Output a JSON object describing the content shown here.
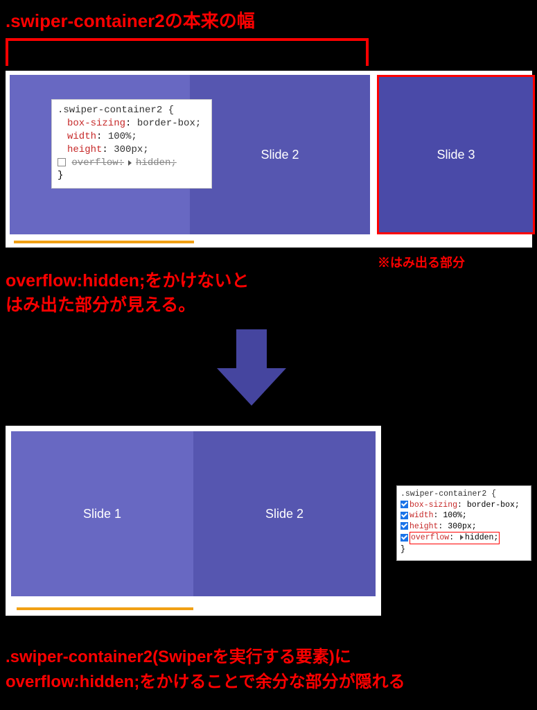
{
  "title": ".swiper-container2の本来の幅",
  "slides_top": {
    "s1": "",
    "s2": "Slide 2",
    "s3": "Slide 3"
  },
  "slides_bottom": {
    "s1": "Slide 1",
    "s2": "Slide 2"
  },
  "devtools_top": {
    "selector": ".swiper-container2 {",
    "p1": "box-sizing",
    "v1": "border-box;",
    "p2": "width",
    "v2": "100%;",
    "p3": "height",
    "v3": "300px;",
    "p4": "overflow:",
    "v4": "hidden;",
    "close": "}"
  },
  "devtools_bottom": {
    "selector": ".swiper-container2 {",
    "p1": "box-sizing",
    "v1": "border-box;",
    "p2": "width",
    "v2": "100%;",
    "p3": "height",
    "v3": "300px;",
    "p4": "overflow",
    "v4": "hidden;",
    "close": "}"
  },
  "notes": {
    "overflow_part": "※はみ出る部分",
    "main_l1": "overflow:hidden;をかけないと",
    "main_l2": "はみ出た部分が見える。",
    "bottom_l1": ".swiper-container2(Swiperを実行する要素)に",
    "bottom_l2": "overflow:hidden;をかけることで余分な部分が隠れる"
  }
}
